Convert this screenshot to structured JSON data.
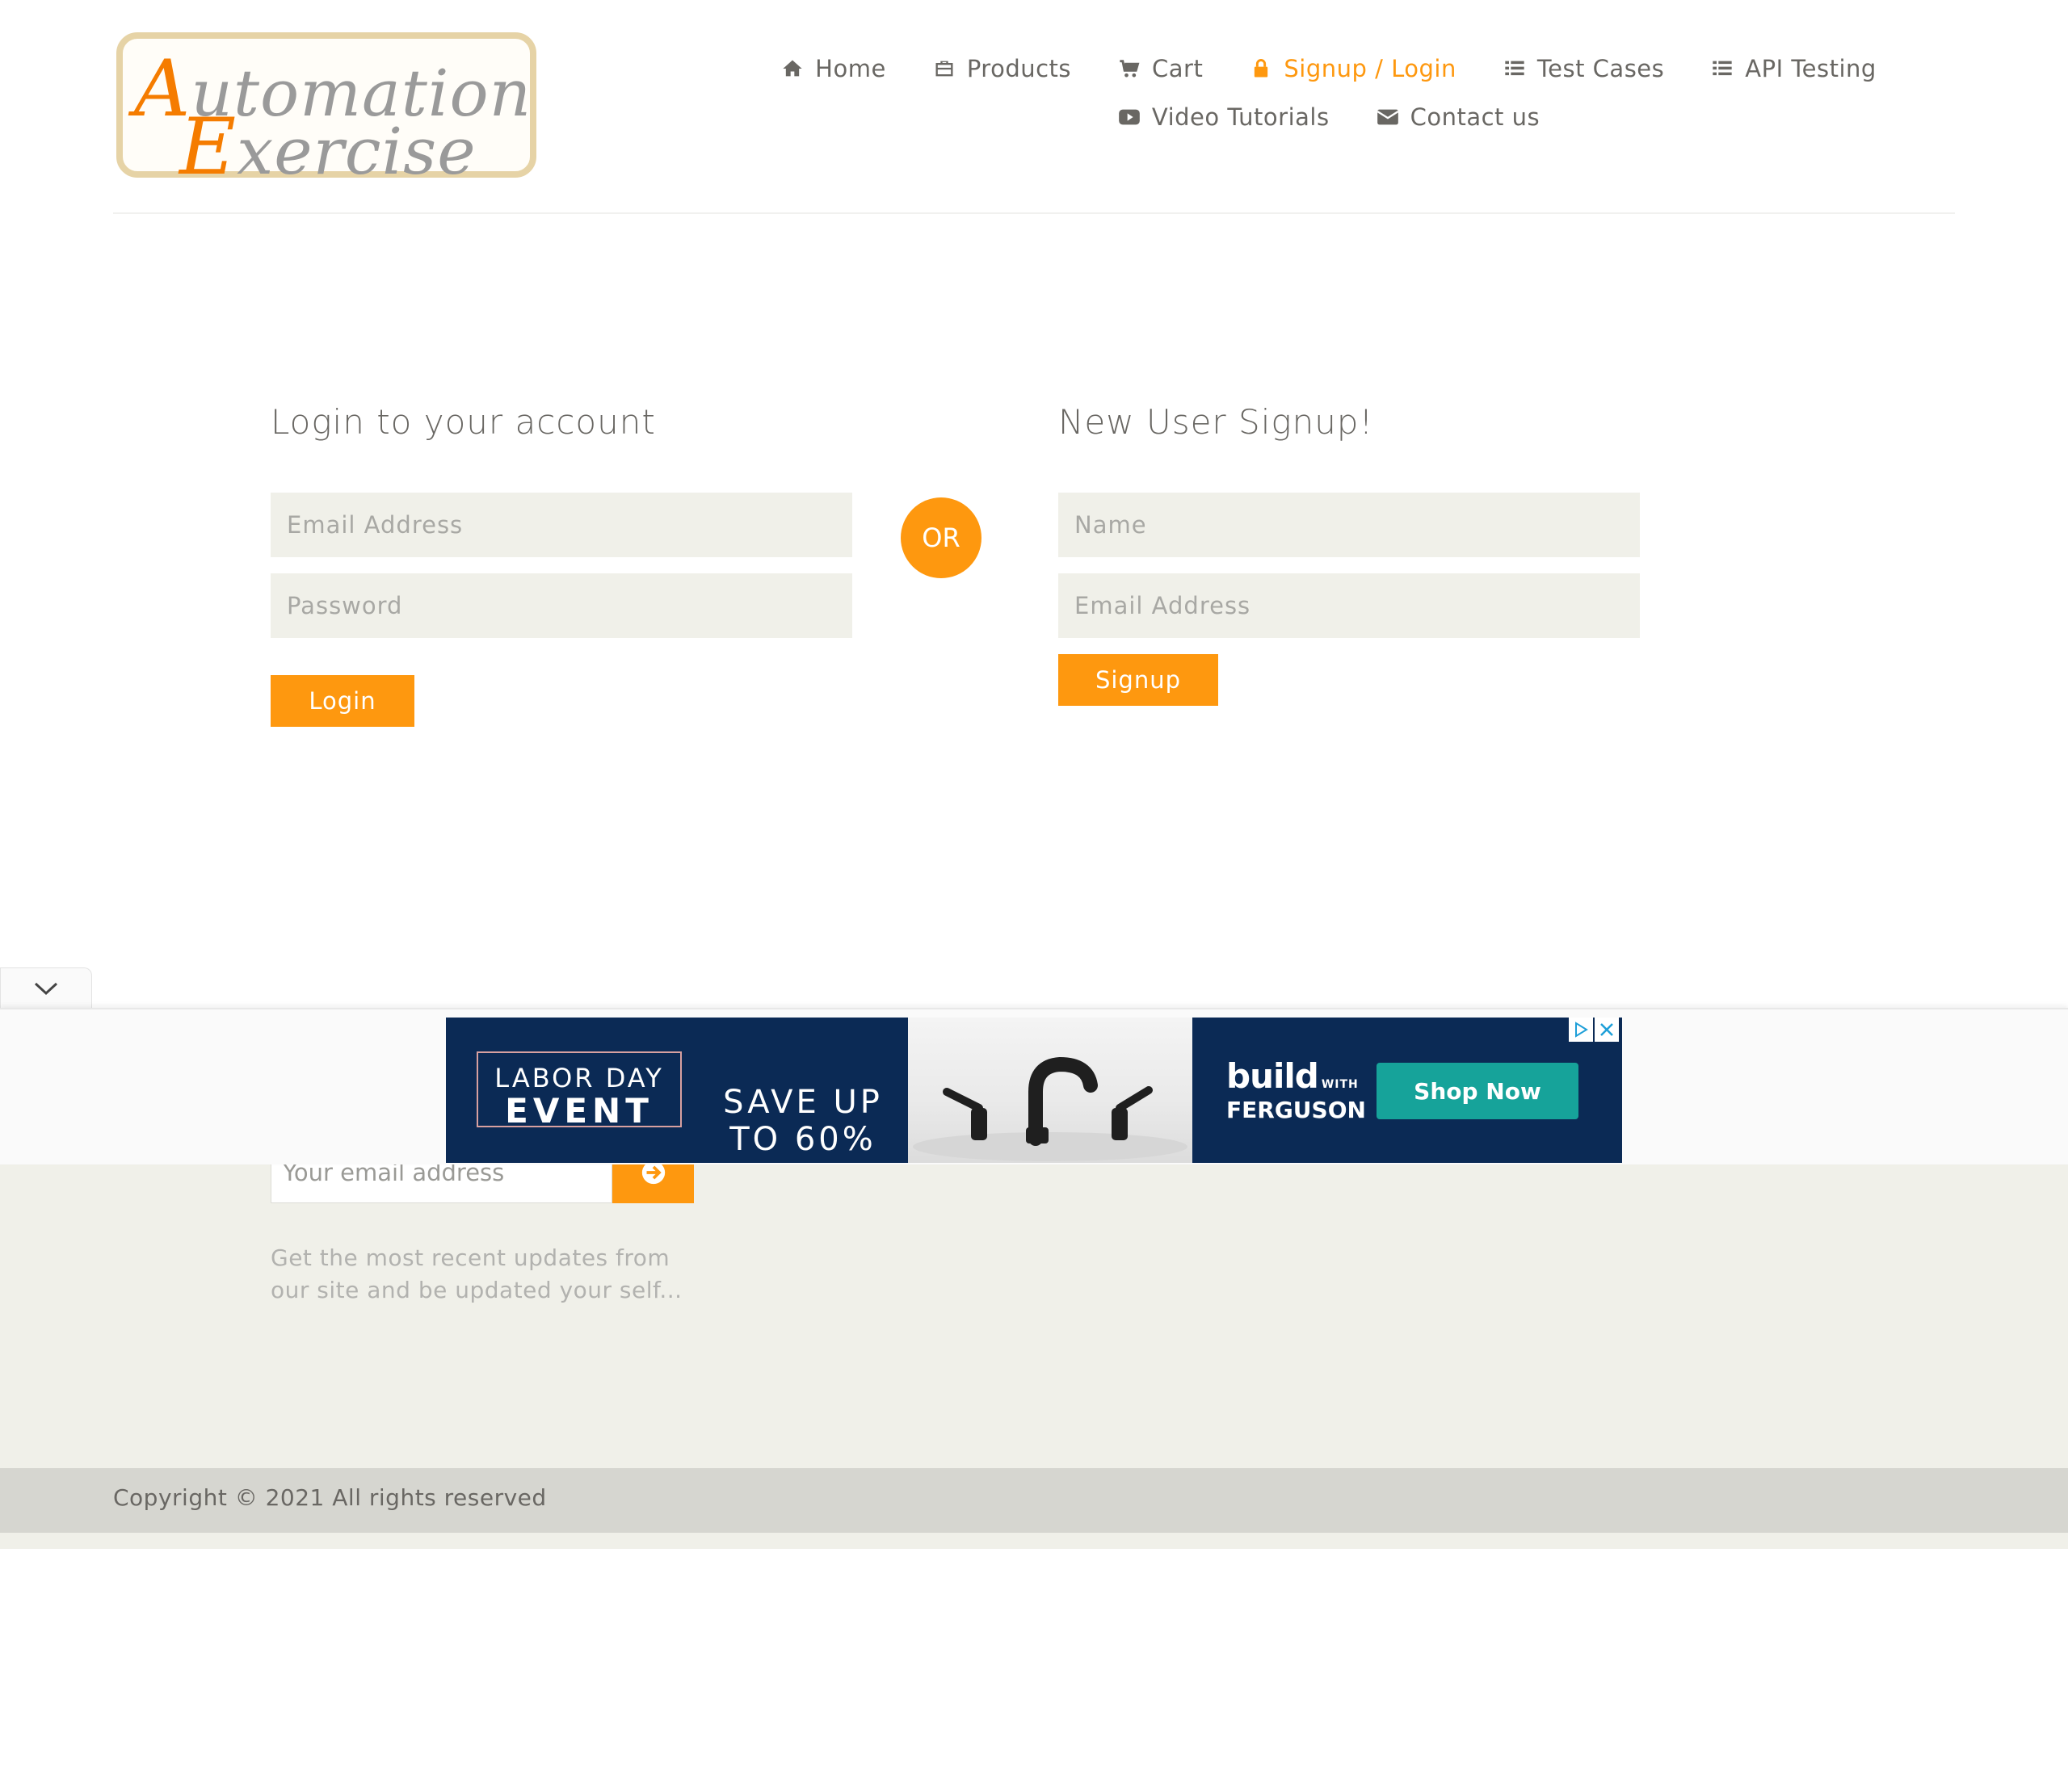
{
  "header": {
    "logo_text_line1": "Automation",
    "logo_text_line2": "Exercise",
    "nav": [
      {
        "label": "Home",
        "icon": "home-icon"
      },
      {
        "label": "Products",
        "icon": "briefcase-icon"
      },
      {
        "label": "Cart",
        "icon": "cart-icon"
      },
      {
        "label": "Signup / Login",
        "icon": "lock-icon",
        "active": true
      },
      {
        "label": "Test Cases",
        "icon": "list-icon"
      },
      {
        "label": "API Testing",
        "icon": "list-icon"
      },
      {
        "label": "Video Tutorials",
        "icon": "youtube-play-icon"
      },
      {
        "label": "Contact us",
        "icon": "envelope-icon"
      }
    ]
  },
  "login": {
    "title": "Login to your account",
    "email_placeholder": "Email Address",
    "password_placeholder": "Password",
    "button": "Login"
  },
  "or_label": "OR",
  "signup": {
    "title": "New User Signup!",
    "name_placeholder": "Name",
    "email_placeholder": "Email Address",
    "button": "Signup"
  },
  "footer": {
    "subscribe_placeholder": "Your email address",
    "subscribe_text": "Get the most recent updates from our site and be updated your self...",
    "copyright": "Copyright © 2021 All rights reserved"
  },
  "ad": {
    "line1": "LABOR DAY",
    "line2": "EVENT",
    "offer_line1": "SAVE UP",
    "offer_line2": "TO 60%",
    "brand_line1": "build",
    "brand_with": "WITH",
    "brand_line2": "FERGUSON",
    "cta": "Shop Now"
  },
  "colors": {
    "accent": "#fe980f",
    "text": "#696763",
    "field_bg": "#f0f0e9",
    "ad_bg": "#0b2a55",
    "ad_cta": "#16a39a"
  }
}
